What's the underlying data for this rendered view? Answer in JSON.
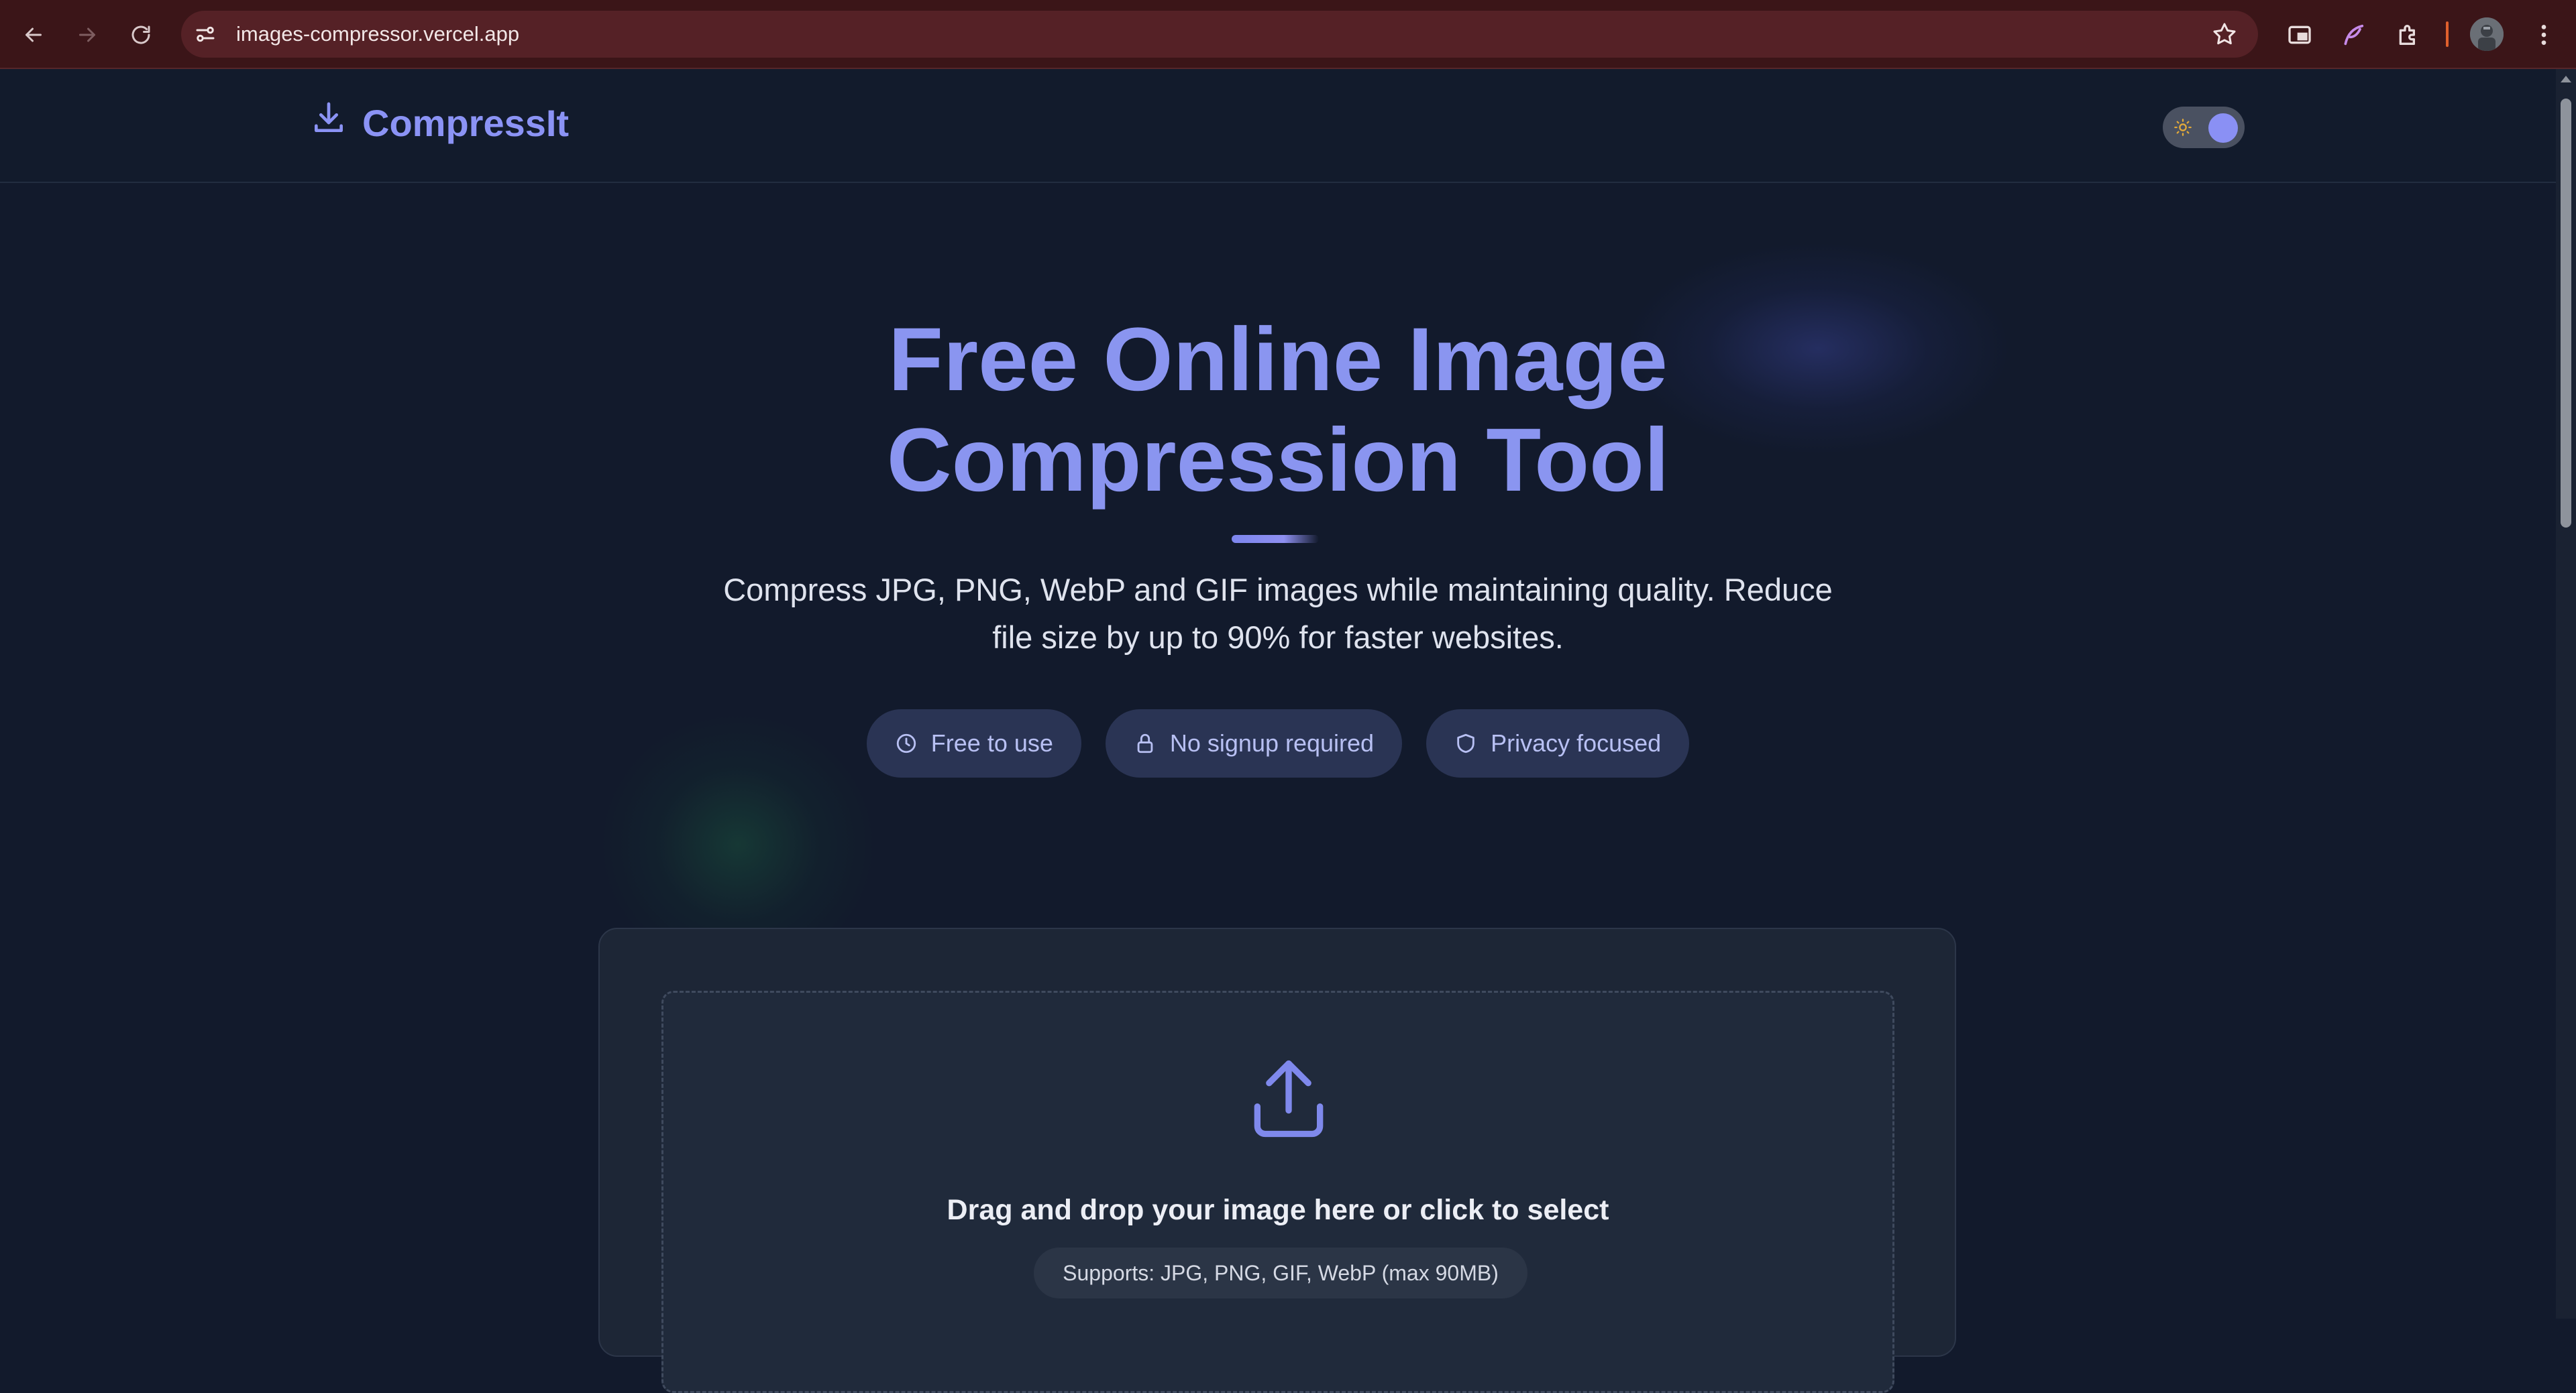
{
  "browser": {
    "url": "images-compressor.vercel.app",
    "accent_color": "#3b1518"
  },
  "header": {
    "logo_text": "CompressIt",
    "logo_icon": "download-icon",
    "theme_toggle": {
      "state": "dark",
      "icon": "sun-icon"
    }
  },
  "hero": {
    "title_line1": "Free Online Image",
    "title_line2": "Compression Tool",
    "subtitle_line1": "Compress JPG, PNG, WebP and GIF images while maintaining quality. Reduce",
    "subtitle_line2": "file size by up to 90% for faster websites.",
    "badges": [
      {
        "label": "Free to use",
        "icon": "clock-icon"
      },
      {
        "label": "No signup required",
        "icon": "lock-icon"
      },
      {
        "label": "Privacy focused",
        "icon": "shield-icon"
      }
    ]
  },
  "upload": {
    "icon": "upload-icon",
    "prompt": "Drag and drop your image here or click to select",
    "supports": "Supports: JPG, PNG, GIF, WebP (max 90MB)"
  },
  "colors": {
    "background": "#121a2c",
    "accent": "#8a95f0",
    "badge_bg": "#2a3454",
    "card_bg": "#1d2636"
  }
}
